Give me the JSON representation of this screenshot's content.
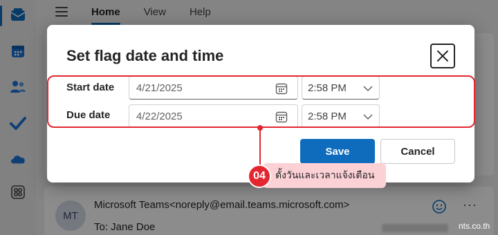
{
  "menu": {
    "tabs": [
      "Home",
      "View",
      "Help"
    ]
  },
  "dialog": {
    "title": "Set flag date and time",
    "start_label": "Start date",
    "start_date": "4/21/2025",
    "start_time": "2:58 PM",
    "due_label": "Due date",
    "due_date": "4/22/2025",
    "due_time": "2:58 PM",
    "save_label": "Save",
    "cancel_label": "Cancel"
  },
  "message": {
    "avatar_initials": "MT",
    "from": "Microsoft Teams<noreply@email.teams.microsoft.com>",
    "to": "To:  Jane Doe",
    "more": "···"
  },
  "annotation": {
    "step": "04",
    "text": "ตั้งวันและเวลาแจ้งเตือน"
  },
  "watermark": "nts.co.th",
  "colors": {
    "accent": "#0f6cbd",
    "annotation_red": "#e3262f",
    "annotation_pink": "#fbd1d6"
  },
  "icons": [
    "mail-icon",
    "calendar-icon",
    "people-icon",
    "todo-check-icon",
    "onedrive-cloud-icon",
    "apps-icon",
    "calendar-picker-icon",
    "chevron-down-icon",
    "close-icon",
    "emoji-icon"
  ]
}
